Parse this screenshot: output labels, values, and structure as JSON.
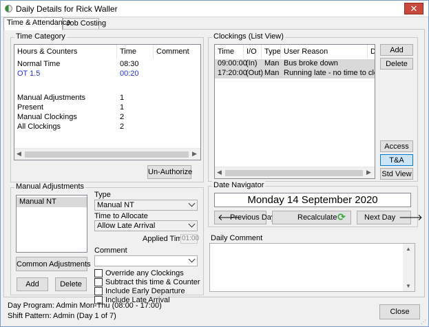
{
  "window": {
    "title": "Daily Details for Rick Waller",
    "close_glyph": "✕"
  },
  "tabs": [
    {
      "label": "Time & Attendance",
      "active": true
    },
    {
      "label": "Job Costing",
      "active": false
    }
  ],
  "time_category": {
    "title": "Time Category",
    "columns": [
      "Hours & Counters",
      "Time",
      "Comment"
    ],
    "rows": [
      {
        "name": "Normal Time",
        "time": "08:30",
        "highlight": false
      },
      {
        "name": "OT 1.5",
        "time": "00:20",
        "highlight": true
      },
      {
        "name": "Manual Adjustments",
        "time": "1",
        "highlight": false
      },
      {
        "name": "Present",
        "time": "1",
        "highlight": false
      },
      {
        "name": "Manual Clockings",
        "time": "2",
        "highlight": false
      },
      {
        "name": "All Clockings",
        "time": "2",
        "highlight": false
      }
    ],
    "unauthorize_label": "Un-Authorize"
  },
  "clockings": {
    "title": "Clockings (List View)",
    "columns": [
      "Time",
      "I/O",
      "Type",
      "User Reason",
      "D"
    ],
    "rows": [
      {
        "time": "09:00:00",
        "io": "(In)",
        "type": "Man",
        "reason": "Bus broke down"
      },
      {
        "time": "17:20:00",
        "io": "(Out)",
        "type": "Man",
        "reason": "Running late - no time to clock"
      }
    ],
    "add_label": "Add",
    "delete_label": "Delete",
    "access_label": "Access",
    "ta_label": "T&A",
    "std_view_label": "Std View"
  },
  "manual_adjustments": {
    "title": "Manual Adjustments",
    "list": [
      "Manual NT"
    ],
    "type_label": "Type",
    "type_value": "Manual NT",
    "allocate_label": "Time to Allocate",
    "allocate_value": "Allow Late Arrival",
    "applied_time_label": "Applied Time",
    "applied_time_value": "01:00",
    "comment_label": "Comment",
    "comment_value": "",
    "common_adjustments_label": "Common Adjustments",
    "add_label": "Add",
    "delete_label": "Delete",
    "checkboxes": [
      {
        "label": "Override any Clockings",
        "checked": false
      },
      {
        "label": "Subtract this time & Counter",
        "checked": false
      },
      {
        "label": "Include Early Departure",
        "checked": false
      },
      {
        "label": "Include Late Arrival",
        "checked": false
      }
    ]
  },
  "date_navigator": {
    "title": "Date Navigator",
    "date": "Monday 14 September 2020",
    "previous_label": "Previous Day",
    "recalculate_label": "Recalculate",
    "next_label": "Next Day"
  },
  "daily_comment": {
    "title": "Daily Comment",
    "value": ""
  },
  "footer": {
    "day_program": "Day Program:  Admin Mon-Thu  (08:00 - 17:00)",
    "shift_pattern": "Shift Pattern:  Admin  (Day 1 of 7)",
    "close_label": "Close"
  },
  "colors": {
    "highlight_text": "#1f2fd0",
    "selected_row": "#d9d9d9",
    "recalc_icon": "#3aa63a"
  }
}
